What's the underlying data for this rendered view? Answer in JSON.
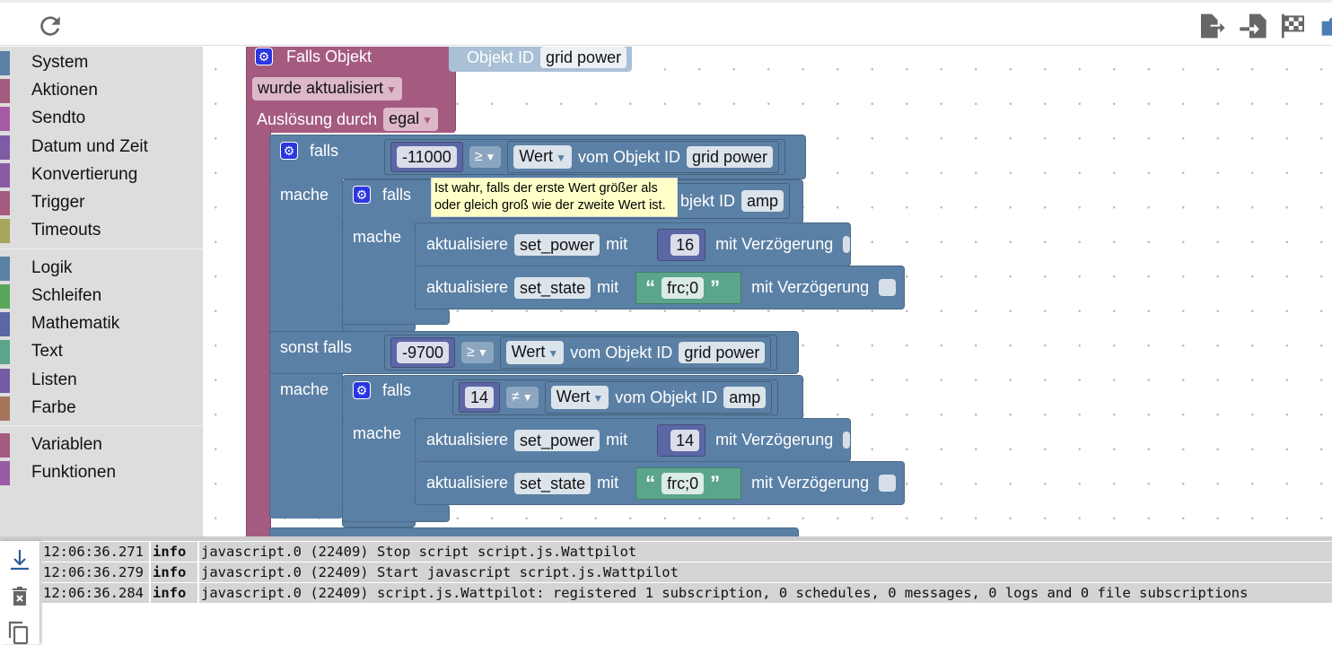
{
  "toolbar": {
    "icons": [
      "reload-icon",
      "export-icon",
      "import-icon",
      "checkered-flag-icon",
      "puzzle-icon"
    ]
  },
  "sidebar": {
    "groups": [
      [
        {
          "label": "System",
          "color": "#5b80a5"
        },
        {
          "label": "Aktionen",
          "color": "#a55b80"
        },
        {
          "label": "Sendto",
          "color": "#a55ba5"
        },
        {
          "label": "Datum und Zeit",
          "color": "#805ba5"
        },
        {
          "label": "Konvertierung",
          "color": "#8a5ba5"
        },
        {
          "label": "Trigger",
          "color": "#a55b80"
        },
        {
          "label": "Timeouts",
          "color": "#a5a55b"
        }
      ],
      [
        {
          "label": "Logik",
          "color": "#5b80a5"
        },
        {
          "label": "Schleifen",
          "color": "#5ba55b"
        },
        {
          "label": "Mathematik",
          "color": "#5b67a5"
        },
        {
          "label": "Text",
          "color": "#5ba58c"
        },
        {
          "label": "Listen",
          "color": "#745ba5"
        },
        {
          "label": "Farbe",
          "color": "#a5745b"
        }
      ],
      [
        {
          "label": "Variablen",
          "color": "#a55b80"
        },
        {
          "label": "Funktionen",
          "color": "#995ba5"
        }
      ]
    ]
  },
  "workspace": {
    "event": {
      "title": "Falls Objekt",
      "oid_label": "Objekt ID",
      "oid_value": "grid power",
      "mode": "wurde aktualisiert",
      "trigger_label": "Auslösung durch",
      "trigger_value": "egal"
    },
    "kw": {
      "falls": "falls",
      "mache": "mache",
      "sonst_falls": "sonst falls",
      "aktualisiere": "aktualisiere",
      "mit": "mit",
      "delay": "mit Verzögerung",
      "wert": "Wert",
      "vom": "vom Objekt ID",
      "open_q": "“",
      "close_q": "”"
    },
    "if1": {
      "num": "-11000",
      "op": "≥",
      "obj": "grid power",
      "inner_tail": "bjekt ID",
      "inner_obj": "amp",
      "set1_var": "set_power",
      "set1_val": "16",
      "set2_var": "set_state",
      "set2_val": "frc;0"
    },
    "if2": {
      "num": "-9700",
      "op": "≥",
      "obj": "grid power",
      "inner_num": "14",
      "inner_op": "≠",
      "inner_obj": "amp",
      "set1_var": "set_power",
      "set1_val": "14",
      "set2_var": "set_state",
      "set2_val": "frc;0"
    },
    "tooltip": "Ist wahr, falls der erste Wert größer als oder gleich groß wie der zweite Wert ist."
  },
  "log": {
    "rows": [
      {
        "time": "12:06:36.271",
        "level": "info",
        "msg": "javascript.0 (22409) Stop script script.js.Wattpilot"
      },
      {
        "time": "12:06:36.279",
        "level": "info",
        "msg": "javascript.0 (22409) Start javascript script.js.Wattpilot"
      },
      {
        "time": "12:06:36.284",
        "level": "info",
        "msg": "javascript.0 (22409) script.js.Wattpilot: registered 1 subscription, 0 schedules, 0 messages, 0 logs and 0 file subscriptions"
      }
    ]
  }
}
